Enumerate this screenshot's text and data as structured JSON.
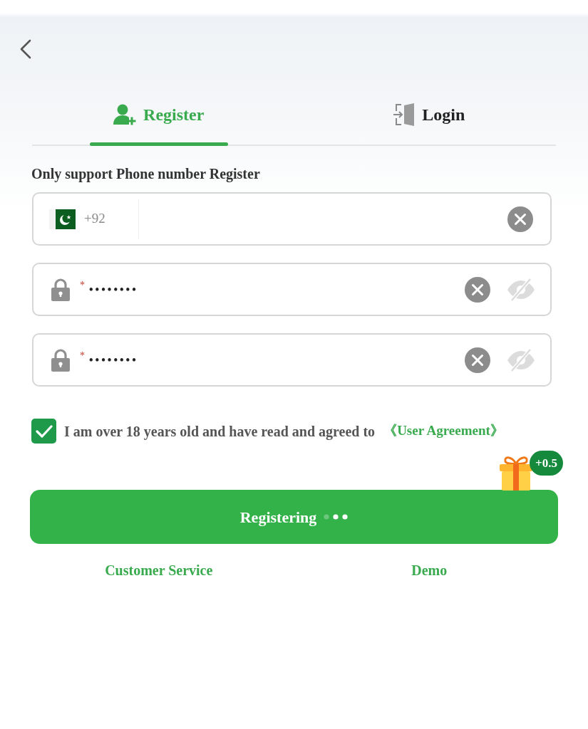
{
  "tabs": [
    {
      "kind": "register",
      "label": "Register",
      "selected": true
    },
    {
      "kind": "login",
      "label": "Login",
      "selected": false
    }
  ],
  "notice": "Only support Phone number Register",
  "fields": [
    {
      "kind": "phone",
      "country_code": "+92"
    },
    {
      "kind": "password",
      "required_mark": "*",
      "value": "••••••••",
      "show_password": false
    },
    {
      "kind": "password",
      "required_mark": "*",
      "value": "••••••••",
      "show_password": false
    }
  ],
  "agreement": {
    "checked": true,
    "text": "I am over 18 years old and have read and agreed to",
    "link": "《User Agreement》"
  },
  "bonus_badge": "+0.5",
  "submit_button": {
    "label": "Registering",
    "loading": true
  },
  "footer_links": [
    "Customer Service",
    "Demo"
  ]
}
